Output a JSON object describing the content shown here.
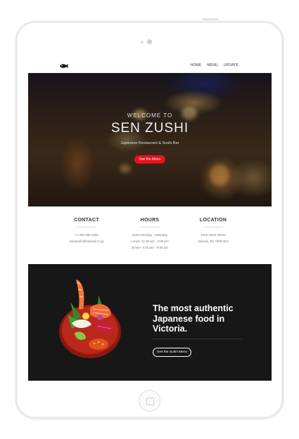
{
  "nav": {
    "logo_icon": "fish-icon",
    "links": [
      "HOME",
      "MENU",
      "UPDATE"
    ]
  },
  "hero": {
    "welcome": "WELCOME TO",
    "title": "SEN ZUSHI",
    "tagline": "Japanese Restaurant & Sushi Bar",
    "button": "See the Menu"
  },
  "info": {
    "contact": {
      "heading": "CONTACT",
      "lines": [
        "+1 250 385 4320",
        "SenZushi@hotmail.co.jp"
      ]
    },
    "hours": {
      "heading": "HOURS",
      "lines": [
        "Open Monday - Saturday",
        "Lunch: 11:30 am - 2:00 pm",
        "Dinner: 5:00 pm - 9:00 pm"
      ]
    },
    "location": {
      "heading": "LOCATION",
      "lines": [
        "1619 Store Street",
        "Victoria, BC V8W 3K3"
      ]
    }
  },
  "promo": {
    "title": "The most authentic Japanese food in Victoria.",
    "button": "See the Sushi Menu"
  },
  "colors": {
    "accent_red": "#e8111d",
    "dark_bg": "#171717",
    "device_frame": "#ffffff"
  }
}
